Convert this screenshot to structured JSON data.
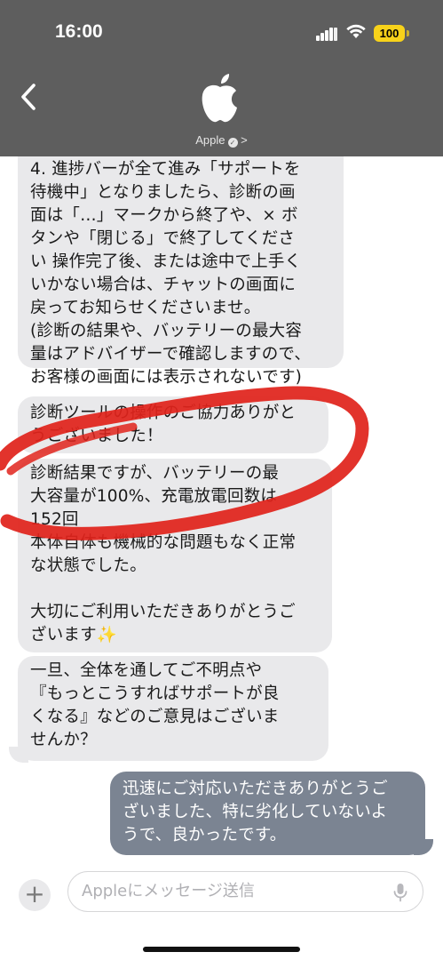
{
  "status_bar": {
    "time": "16:00",
    "battery": "100"
  },
  "header": {
    "contact_name": "Apple",
    "contact_chevron": ">"
  },
  "messages": [
    {
      "from": "them",
      "text": "4. 進捗バーが全て進み「サポートを\n待機中」となりましたら、診断の画\n面は「…」マークから終了や、× ボ\nタンや「閉じる」で終了してくださ\nい 操作完了後、または途中で上手く\nいかない場合は、チャットの画面に\n戻ってお知らせくださいませ。\n(診断の結果や、バッテリーの最大容\n量はアドバイザーで確認しますので、\nお客様の画面には表示されないです)"
    },
    {
      "from": "them",
      "text": "診断ツールの操作のご協力ありがと\nうございました！"
    },
    {
      "from": "them",
      "text": "診断結果ですが、バッテリーの最\n大容量が100%、充電放電回数は\n152回\n本体自体も機械的な問題もなく正常\nな状態でした。\n\n大切にご利用いただきありがとうご\nざいます✨"
    },
    {
      "from": "them",
      "text": "一旦、全体を通してご不明点や\n『もっとこうすればサポートが良\nくなる』などのご意見はございま\nせんか？"
    },
    {
      "from": "me",
      "text": "迅速にご対応いただきありがとうご\nざいました、特に劣化していないよ\nうで、良かったです。"
    }
  ],
  "composer": {
    "placeholder": "Appleにメッセージ送信"
  },
  "colors": {
    "header_bg": "#5e5e5e",
    "incoming_bubble": "#e9e9eb",
    "outgoing_bubble": "#7b8492",
    "annotation": "#e0231c",
    "battery": "#f7d21a"
  },
  "icons": [
    "signal-icon",
    "wifi-icon",
    "battery-icon",
    "back-chevron-icon",
    "apple-logo-icon",
    "verified-badge-icon",
    "plus-icon",
    "mic-icon"
  ]
}
